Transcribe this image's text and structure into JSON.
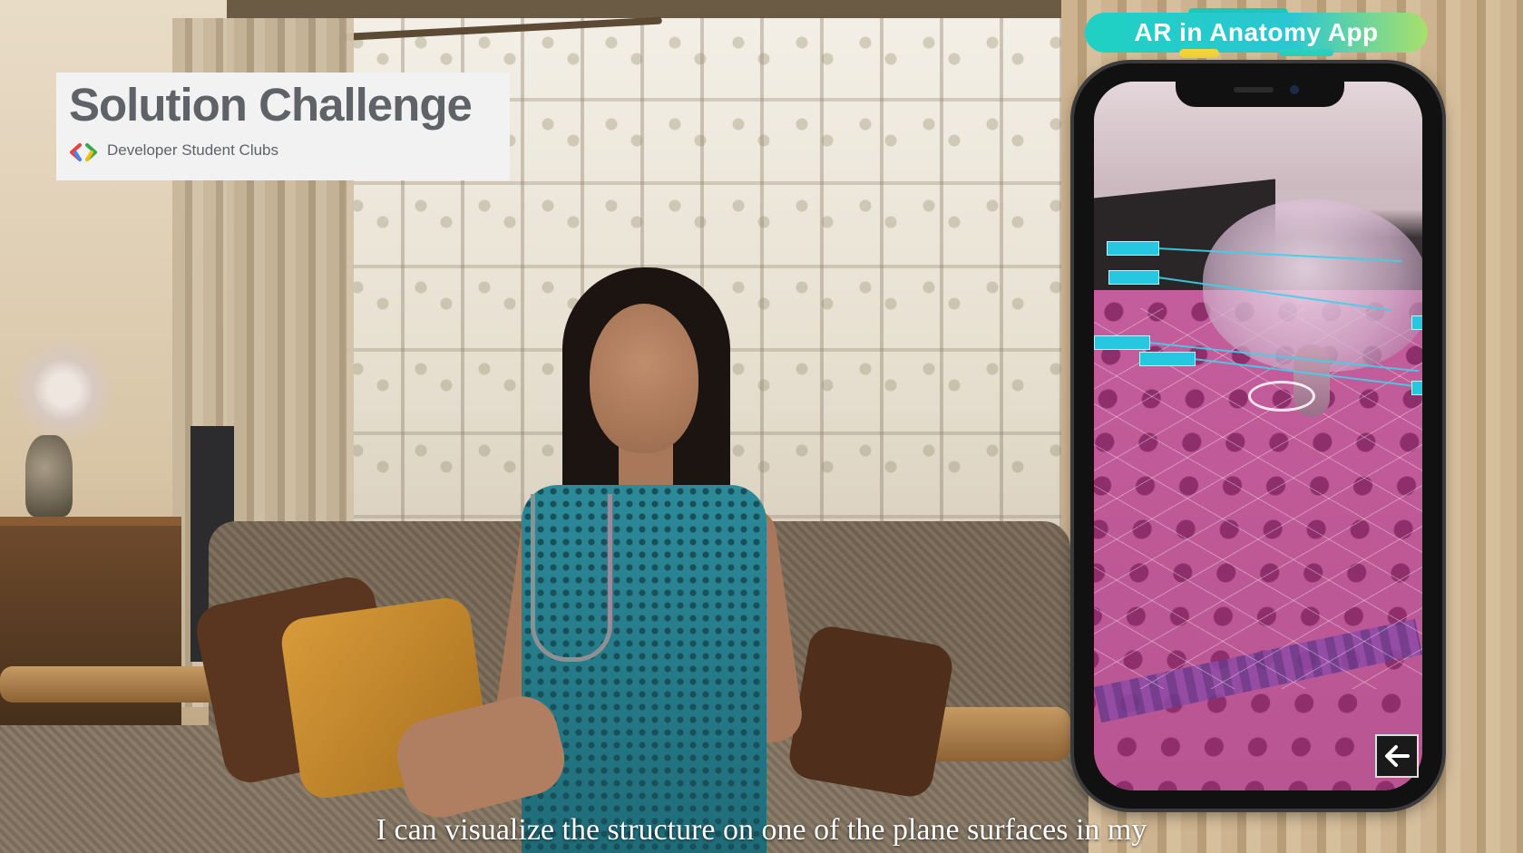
{
  "branding": {
    "title": "Solution Challenge",
    "subtitle": "Developer Student Clubs"
  },
  "banner": {
    "title": "AR in Anatomy App"
  },
  "phone": {
    "back_button_label": "🡐"
  },
  "caption": {
    "text": "I can visualize the structure on one of the plane surfaces in my"
  },
  "colors": {
    "banner_teal": "#1fd1c2",
    "banner_green": "#a8e06b",
    "banner_yellow": "#f3d53b",
    "logo_text": "#5f6368",
    "ar_label": "#25c8e0"
  }
}
